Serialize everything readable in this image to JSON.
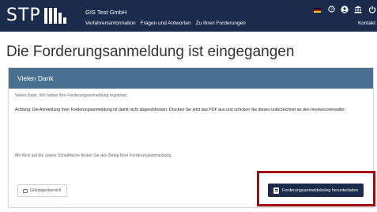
{
  "header": {
    "logo_text": "STP",
    "company": "GIS Test GmbH",
    "nav": [
      "Verfahrensinformation",
      "Fragen und Antworten",
      "Zu Ihren Forderungen"
    ],
    "contact": "Kontakt",
    "icons": [
      "germany-flag-icon",
      "help-circle-icon",
      "user-icon",
      "bank-icon",
      "power-icon"
    ]
  },
  "page": {
    "title": "Die Forderungsanmeldung ist eingegangen"
  },
  "card": {
    "header": "Vielen Dank",
    "msg1": "Vielen Dank. Wir haben Ihre Forderungsanmeldung registriert.",
    "msg2": "Achtung: Die Anmeldung Ihrer Forderungsanmeldung ist damit nicht abgeschlossen. Drucken Sie jetzt das PDF aus und schicken Sie dieses unterzeichnet an den Insolvenzverwalter.",
    "msg3": "Mit Klick auf die untere Schaltfläche finden Sie den Beleg Ihrer Forderungsanmeldung.",
    "btn_glaubiger": "Gläubigerbereich",
    "btn_download": "Forderungsanmeldebeleg herunterladen"
  },
  "colors": {
    "header_bg": "#1b2b4b",
    "card_header_bg": "#4a7091",
    "highlight": "#a30d12"
  }
}
